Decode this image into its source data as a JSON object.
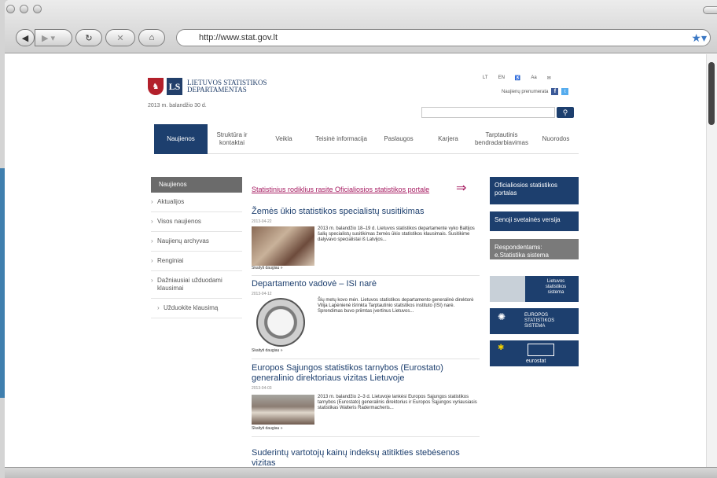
{
  "browser": {
    "url": "http://www.stat.gov.lt",
    "back_icon": "back-icon",
    "forward_icon": "forward-icon",
    "reload_icon": "reload-icon",
    "stop_icon": "stop-icon",
    "home_icon": "home-icon",
    "bookmark_icon": "star-icon"
  },
  "header": {
    "logo_line1": "LIETUVOS STATISTIKOS",
    "logo_line2": "DEPARTAMENTAS",
    "logo_mark": "LS",
    "date": "2013 m. balandžio 30 d.",
    "lang_lt": "LT",
    "lang_en": "EN",
    "font_size": "Aa",
    "subscribe": "Naujienų prenumerata",
    "facebook": "f",
    "twitter": "t"
  },
  "nav": [
    {
      "label": "Naujienos",
      "active": true
    },
    {
      "label": "Struktūra ir kontaktai"
    },
    {
      "label": "Veikla"
    },
    {
      "label": "Teisinė informacija"
    },
    {
      "label": "Paslaugos"
    },
    {
      "label": "Karjera"
    },
    {
      "label": "Tarptautinis bendradarbiavimas"
    },
    {
      "label": "Nuorodos"
    }
  ],
  "left_menu": {
    "title": "Naujienos",
    "items": [
      "Aktualijos",
      "Visos naujienos",
      "Naujienų archyvas",
      "Renginiai",
      "Dažniausiai užduodami klausimai",
      "Užduokite klausimą"
    ]
  },
  "banner": {
    "text": "Statistinius rodiklius rasite Oficialiosios statistikos portale",
    "arrow": "⇒"
  },
  "articles": [
    {
      "title": "Žemės ūkio statistikos specialistų susitikimas",
      "date": "2013-04-22",
      "text": "2013 m. balandžio 18–19 d. Lietuvos statistikos departamente vyko Baltijos šalių specialistų susitikimas žemės ūkio statistikos klausimais. Susitikime dalyvavo specialistai iš Latvijos...",
      "more": "Skaityti daugiau »"
    },
    {
      "title": "Departamento vadovė – ISI narė",
      "date": "2013-04-12",
      "text": "Šių metų kovo mėn. Lietuvos statistikos departamento generalinė direktorė Vilija Lapėnienė išrinkta Tarptautinio statistikos instituto (ISI) narė. Sprendimas buvo priimtas įvertinus Lietuvos...",
      "more": "Skaityti daugiau »"
    },
    {
      "title": "Europos Sąjungos statistikos tarnybos (Eurostato) generalinio direktoriaus vizitas Lietuvoje",
      "date": "2013-04-03",
      "text": "2013 m. balandžio 2–3 d. Lietuvoje lankėsi Europos Sąjungos statistikos tarnybos (Eurostato) generalinis direktorius ir Europos Sąjungos vyriausiasis statistikas Walteris Radermacheris...",
      "more": "Skaityti daugiau »"
    },
    {
      "title": "Suderintų vartotojų kainų indeksų atitikties stebėsenos vizitas",
      "date": "",
      "text": "",
      "more": ""
    }
  ],
  "right_boxes": [
    {
      "label": "Oficialiosios statistikos portalas"
    },
    {
      "label": "Senoji svetainės versija"
    },
    {
      "label": "Respondentams: e.Statistika sistema"
    }
  ],
  "right_images": [
    {
      "label": "Lietuvos statistikos sistema"
    },
    {
      "label": "EUROPOS STATISTIKOS SISTEMA"
    },
    {
      "label": "eurostat"
    }
  ]
}
